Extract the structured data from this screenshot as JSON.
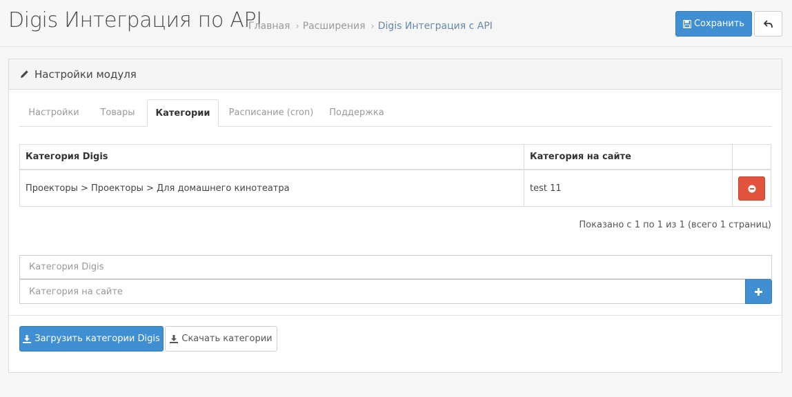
{
  "header": {
    "title": "Digis Интеграция по API",
    "breadcrumbs": [
      {
        "label": "Главная"
      },
      {
        "label": "Расширения"
      },
      {
        "label": "Digis Интеграция с API"
      }
    ],
    "save_label": "Сохранить",
    "save_icon": "floppy-disk-icon",
    "back_icon": "reply-arrow-icon"
  },
  "panel": {
    "heading": "Настройки модуля",
    "heading_icon": "pencil-icon",
    "tabs": [
      {
        "label": "Настройки"
      },
      {
        "label": "Товары"
      },
      {
        "label": "Категории",
        "active": true
      },
      {
        "label": "Расписание (cron)"
      },
      {
        "label": "Поддержка"
      }
    ],
    "table": {
      "columns": [
        "Категория Digis",
        "Категория на сайте",
        ""
      ],
      "rows": [
        {
          "digis": "Проекторы > Проекторы > Для домашнего кинотеатра",
          "site": "test 11",
          "action_icon": "minus-circle-icon"
        }
      ]
    },
    "pagination_info": "Показано с 1 по 1 из 1 (всего 1 страниц)",
    "form": {
      "digis_placeholder": "Категория Digis",
      "site_placeholder": "Категория на сайте",
      "add_icon": "plus-icon"
    },
    "footer": {
      "load_label": "Загрузить категории Digis",
      "download_label": "Скачать категории",
      "download_icon": "download-icon"
    }
  },
  "colors": {
    "primary": "#3f8fd2",
    "danger": "#e2533d",
    "breadcrumb_active": "#6688aa"
  }
}
